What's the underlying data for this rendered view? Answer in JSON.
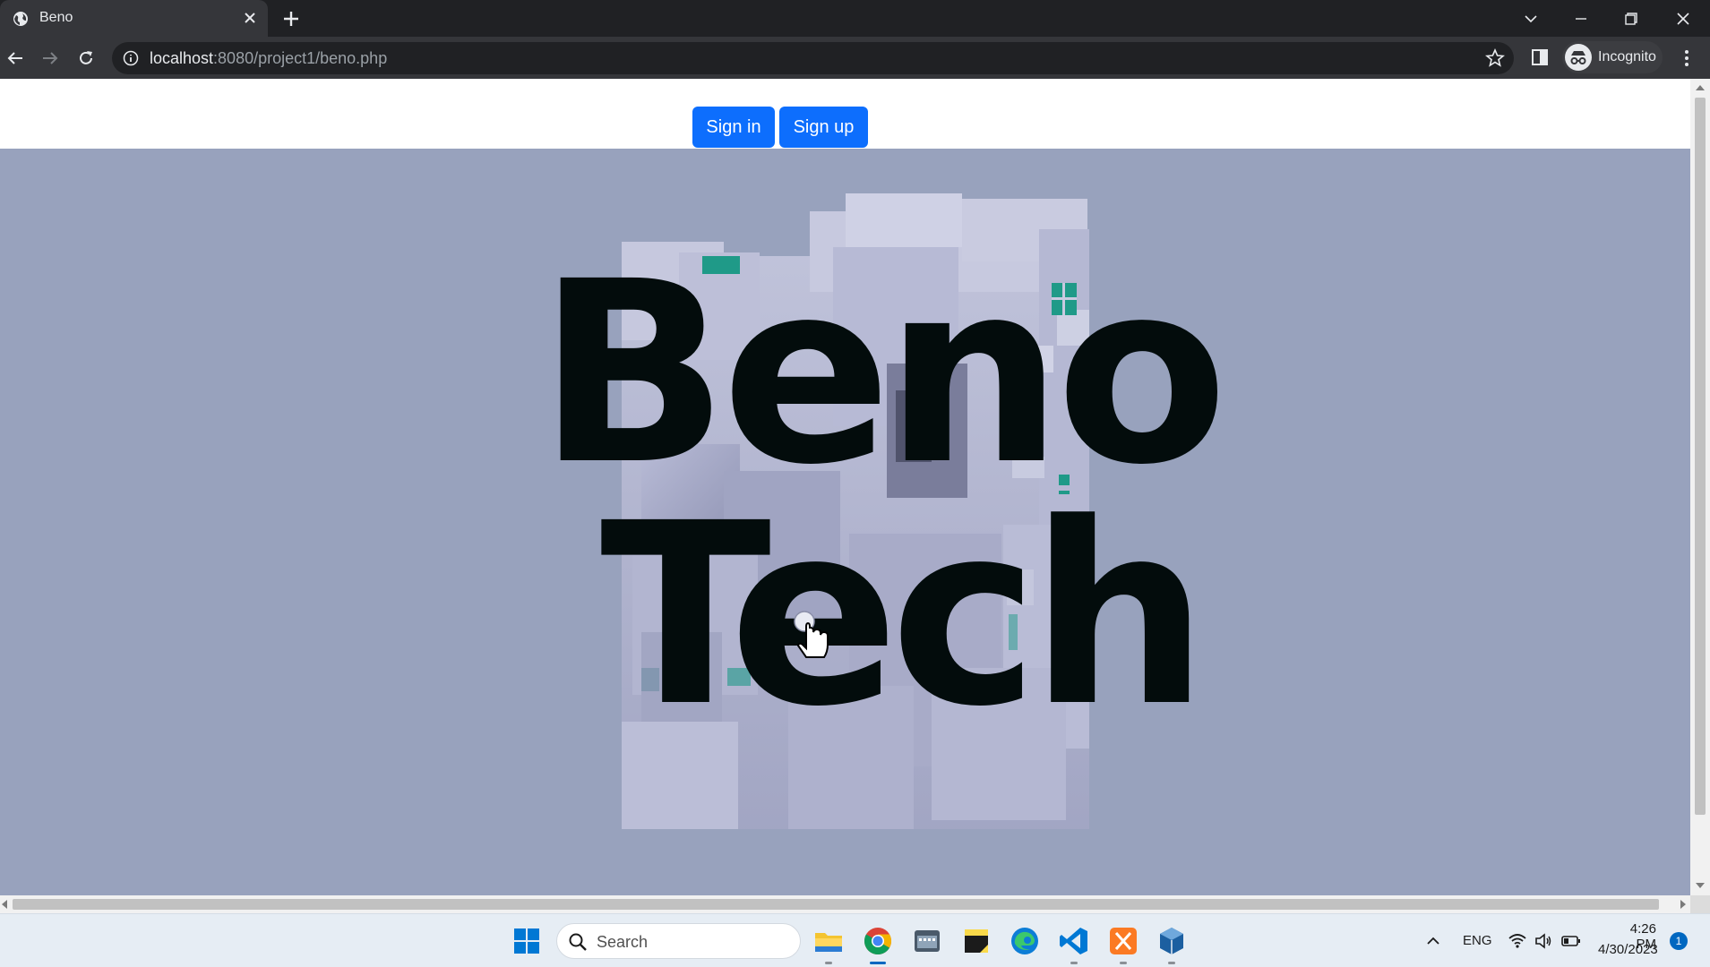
{
  "browser": {
    "tab_title": "Beno",
    "url_host": "localhost",
    "url_rest": ":8080/project1/beno.php",
    "profile_label": "Incognito"
  },
  "page": {
    "signin_label": "Sign in",
    "signup_label": "Sign up",
    "hero_line1": "Beno",
    "hero_line2": "Tech"
  },
  "taskbar": {
    "search_placeholder": "Search",
    "language": "ENG",
    "time": "4:26 PM",
    "date": "4/30/2023",
    "notification_count": "1"
  },
  "colors": {
    "primary_button": "#0d6efd",
    "hero_background": "#98a2bd",
    "hero_text": "#030c0c",
    "accent_teal": "#1f9a88"
  }
}
